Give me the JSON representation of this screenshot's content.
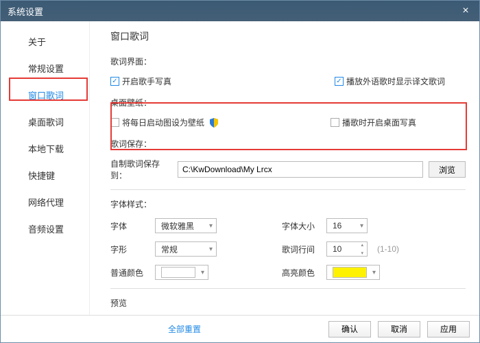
{
  "window": {
    "title": "系统设置"
  },
  "sidebar": {
    "items": [
      {
        "label": "关于"
      },
      {
        "label": "常规设置"
      },
      {
        "label": "窗口歌词"
      },
      {
        "label": "桌面歌词"
      },
      {
        "label": "本地下载"
      },
      {
        "label": "快捷键"
      },
      {
        "label": "网络代理"
      },
      {
        "label": "音频设置"
      }
    ]
  },
  "page": {
    "title": "窗口歌词",
    "section_interface": "歌词界面：",
    "chk_singer_photo": "开启歌手写真",
    "chk_translation": "播放外语歌时显示译文歌词",
    "section_wallpaper": "桌面壁纸：",
    "chk_daily_wallpaper": "将每日启动图设为壁纸",
    "chk_play_wallpaper": "播歌时开启桌面写真",
    "section_save": "歌词保存：",
    "save_label": "自制歌词保存到：",
    "save_path": "C:\\KwDownload\\My Lrcx",
    "browse": "浏览",
    "section_font": "字体样式：",
    "font_label": "字体",
    "font_value": "微软雅黑",
    "font_size_label": "字体大小",
    "font_size_value": "16",
    "style_label": "字形",
    "style_value": "常规",
    "line_spacing_label": "歌词行间",
    "line_spacing_value": "10",
    "line_spacing_hint": "(1-10)",
    "normal_color_label": "普通颜色",
    "highlight_color_label": "高亮颜色",
    "highlight_color_value": "#fff200",
    "preview_label": "预览"
  },
  "footer": {
    "reset": "全部重置",
    "ok": "确认",
    "cancel": "取消",
    "apply": "应用"
  }
}
